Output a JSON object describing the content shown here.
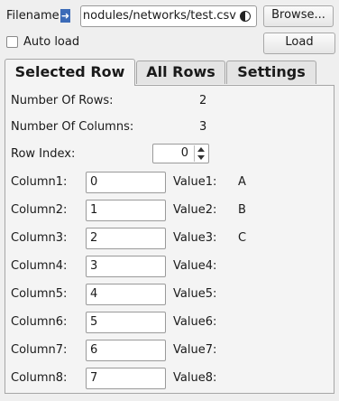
{
  "header": {
    "filename_label": "Filename:",
    "filename_value": "nodules/networks/test.csv",
    "browse_label": "Browse...",
    "autoload_label": "Auto load",
    "autoload_checked": false,
    "load_label": "Load"
  },
  "tabs": [
    {
      "label": "Selected Row",
      "selected": true
    },
    {
      "label": "All Rows",
      "selected": false
    },
    {
      "label": "Settings",
      "selected": false
    }
  ],
  "info": {
    "rows_label": "Number Of Rows:",
    "rows_value": "2",
    "columns_label": "Number Of Columns:",
    "columns_value": "3",
    "row_index_label": "Row Index:",
    "row_index_value": "0"
  },
  "rows": [
    {
      "col_label": "Column1:",
      "col_value": "0",
      "val_label": "Value1:",
      "val_value": "A"
    },
    {
      "col_label": "Column2:",
      "col_value": "1",
      "val_label": "Value2:",
      "val_value": "B"
    },
    {
      "col_label": "Column3:",
      "col_value": "2",
      "val_label": "Value3:",
      "val_value": "C"
    },
    {
      "col_label": "Column4:",
      "col_value": "3",
      "val_label": "Value4:",
      "val_value": ""
    },
    {
      "col_label": "Column5:",
      "col_value": "4",
      "val_label": "Value5:",
      "val_value": ""
    },
    {
      "col_label": "Column6:",
      "col_value": "5",
      "val_label": "Value6:",
      "val_value": ""
    },
    {
      "col_label": "Column7:",
      "col_value": "6",
      "val_label": "Value7:",
      "val_value": ""
    },
    {
      "col_label": "Column8:",
      "col_value": "7",
      "val_label": "Value8:",
      "val_value": ""
    }
  ]
}
